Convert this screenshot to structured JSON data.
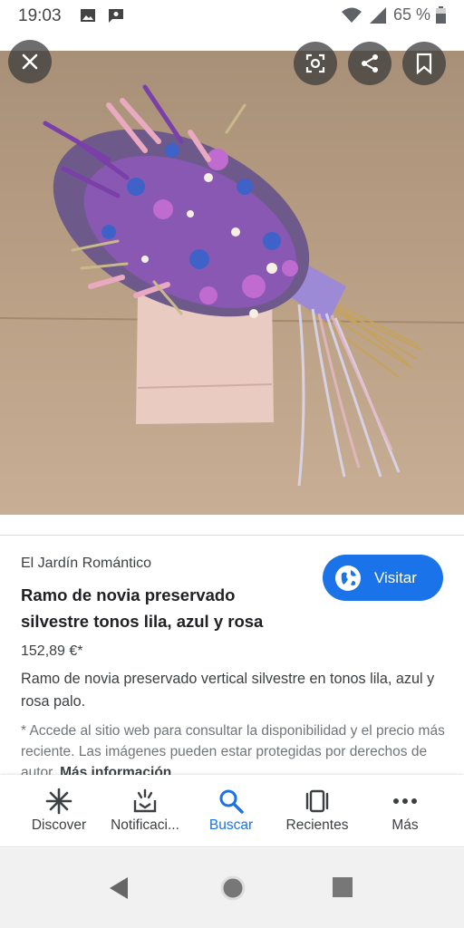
{
  "status_bar": {
    "time": "19:03",
    "battery_percent": "65 %",
    "icons": [
      "image-icon",
      "chat-icon",
      "wifi-icon",
      "signal-icon",
      "battery-icon"
    ]
  },
  "image_viewer": {
    "buttons": [
      "close-icon",
      "lens-icon",
      "share-icon",
      "bookmark-icon"
    ],
    "colors": {
      "background": "#b59a80",
      "lilac": "#8e58b8",
      "blue": "#3e62c8",
      "pink": "#e9a9c0"
    }
  },
  "result": {
    "site_name": "El Jardín Romántico",
    "title": "Ramo de novia preservado silvestre tonos lila, azul y rosa",
    "price": "152,89 €*",
    "description": "Ramo de novia preservado vertical silvestre en tonos lila, azul y rosa palo.",
    "visit_label": "Visitar",
    "notice_text": "* Accede al sitio web para consultar la disponibilidad y el precio más reciente. Las imágenes pueden estar protegidas por derechos de autor. ",
    "notice_link": "Más información"
  },
  "bottom_nav": {
    "items": [
      {
        "label": "Discover",
        "icon": "asterisk-icon"
      },
      {
        "label": "Notificaci...",
        "icon": "notifications-icon"
      },
      {
        "label": "Buscar",
        "icon": "search-icon"
      },
      {
        "label": "Recientes",
        "icon": "recents-icon"
      },
      {
        "label": "Más",
        "icon": "more-icon"
      }
    ],
    "active_index": 2,
    "accent_color": "#1a73e8"
  },
  "system_nav": {
    "icons": [
      "back-icon",
      "home-icon",
      "overview-icon"
    ]
  }
}
